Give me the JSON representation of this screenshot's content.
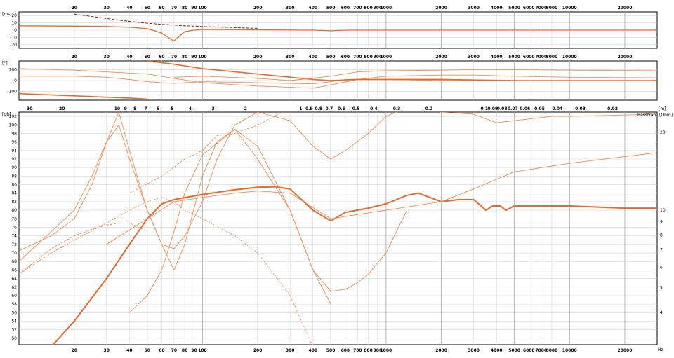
{
  "colors": {
    "grid": "#d4d4d4",
    "grid_major": "#a8a8a8",
    "frame": "#000000",
    "curve_main": "#e9692c",
    "curve_thin": "#f08a50",
    "curve_dark": "#8b1a1a"
  },
  "chart_data": [
    {
      "type": "line",
      "panel": "top",
      "xscale": "log",
      "xlim": [
        10,
        30000
      ],
      "x_ticks": [
        "20",
        "30",
        "40",
        "50",
        "60",
        "70",
        "80",
        "90",
        "100",
        "200",
        "300",
        "400",
        "500",
        "600",
        "700",
        "800",
        "900",
        "1000",
        "2000",
        "3000",
        "4000",
        "5000",
        "6000",
        "7000",
        "8000",
        "10000",
        "20000"
      ],
      "ylabel": "[ms]",
      "y_ticks": [
        "20",
        "10",
        "0",
        "-10",
        "-20"
      ],
      "ylim": [
        -25,
        25
      ],
      "series": [
        {
          "role": "group-delay",
          "x": [
            20,
            30,
            40,
            50,
            60,
            70,
            80,
            90,
            100,
            150,
            200
          ],
          "y": [
            22,
            16,
            12,
            9.5,
            8,
            7,
            6,
            5.5,
            5,
            3.5,
            2.5
          ]
        },
        {
          "role": "phase-delay",
          "x": [
            10,
            20,
            30,
            40,
            50,
            55,
            60,
            65,
            70,
            75,
            80,
            90,
            100,
            200,
            400,
            500,
            600,
            1000,
            30000
          ],
          "y": [
            6,
            5.5,
            5,
            4,
            2,
            -1,
            -4,
            -10,
            -15,
            -8,
            -2,
            0,
            1,
            0.5,
            0,
            -1,
            0,
            0,
            0
          ]
        }
      ]
    },
    {
      "type": "line",
      "panel": "middle",
      "xscale": "log",
      "xlim": [
        10,
        30000
      ],
      "x_ticks": [
        "20",
        "30",
        "40",
        "50",
        "60",
        "70",
        "80",
        "90",
        "100",
        "200",
        "300",
        "400",
        "500",
        "600",
        "700",
        "800",
        "900",
        "1000",
        "2000",
        "3000",
        "4000",
        "5000",
        "6000",
        "7000",
        "8000",
        "10000",
        "20000"
      ],
      "ylabel": "[°]",
      "y_ticks": [
        "100",
        "0",
        "-100"
      ],
      "ylim": [
        -180,
        180
      ],
      "series": [
        {
          "role": "phase-a",
          "x": [
            10,
            20,
            50,
            70,
            100,
            200,
            400,
            500,
            700,
            1000,
            2000,
            3000,
            5000,
            10000,
            30000
          ],
          "y": [
            110,
            95,
            60,
            20,
            -20,
            -50,
            -70,
            -40,
            10,
            40,
            50,
            50,
            40,
            30,
            25
          ]
        },
        {
          "role": "phase-b",
          "x": [
            10,
            20,
            30,
            40,
            50,
            60,
            70,
            80,
            100,
            200,
            400,
            500,
            600,
            1000,
            2000,
            5000,
            30000
          ],
          "y": [
            40,
            40,
            30,
            10,
            -10,
            -20,
            -25,
            -20,
            -10,
            -20,
            -30,
            -10,
            10,
            10,
            0,
            0,
            0
          ]
        },
        {
          "role": "phase-c",
          "x": [
            10,
            20,
            40,
            50
          ],
          "y": [
            -120,
            -140,
            -160,
            -170
          ]
        },
        {
          "role": "phase-d",
          "x": [
            50,
            70,
            100,
            200,
            400,
            500,
            700,
            1000,
            2000,
            5000,
            30000
          ],
          "y": [
            180,
            150,
            110,
            60,
            10,
            0,
            10,
            10,
            10,
            0,
            0
          ]
        },
        {
          "role": "phase-e",
          "x": [
            70,
            100,
            200,
            300,
            500,
            700,
            1000,
            2000,
            3000,
            5000,
            10000,
            30000
          ],
          "y": [
            30,
            40,
            20,
            0,
            40,
            80,
            90,
            95,
            100,
            100,
            95,
            90
          ]
        }
      ]
    },
    {
      "type": "line",
      "panel": "main",
      "xscale": "log",
      "xlim": [
        10,
        30000
      ],
      "x_ticks": [
        "20",
        "30",
        "40",
        "50",
        "60",
        "70",
        "80",
        "90",
        "100",
        "200",
        "300",
        "400",
        "500",
        "600",
        "700",
        "800",
        "900",
        "1000",
        "2000",
        "3000",
        "4000",
        "5000",
        "6000",
        "7000",
        "8000",
        "10000",
        "20000"
      ],
      "x_unit": "Hz",
      "wavelength_ticks": [
        "30",
        "20",
        "10",
        "9",
        "8",
        "7",
        "6",
        "5",
        "4",
        "3",
        "2",
        "1",
        "0.9",
        "0.8",
        "0.7",
        "0.6",
        "0.5",
        "0.4",
        "0.3",
        "0.2",
        "0.1",
        "0.09",
        "0.08",
        "0.07",
        "0.06",
        "0.05",
        "0.04",
        "0.03",
        "0.02"
      ],
      "wavelength_unit": "[m]",
      "ylabel": "[dB]",
      "y_ticks": [
        "102",
        "100",
        "98",
        "96",
        "94",
        "92",
        "90",
        "88",
        "86",
        "84",
        "82",
        "80",
        "78",
        "76",
        "74",
        "72",
        "70",
        "68",
        "66",
        "64",
        "62",
        "60",
        "58",
        "56",
        "54",
        "52",
        "50"
      ],
      "ylim": [
        48.5,
        103
      ],
      "y2label": "[Ohm]",
      "y2_ticks": [
        "20",
        "10",
        "9",
        "8",
        "7",
        "6",
        "5",
        "4"
      ],
      "y2lim": [
        3,
        24
      ],
      "legend_stub": "Basstrap",
      "series": [
        {
          "role": "main-response",
          "x": [
            15,
            20,
            30,
            40,
            50,
            60,
            70,
            100,
            150,
            200,
            250,
            300,
            400,
            500,
            600,
            800,
            1000,
            1300,
            1500,
            2000,
            2500,
            3000,
            3500,
            3800,
            4200,
            4500,
            5000,
            6000,
            10000,
            20000,
            30000
          ],
          "y": [
            48,
            54,
            64,
            72,
            78,
            81.5,
            82.5,
            83.7,
            84.8,
            85.4,
            85.5,
            85,
            80,
            77.5,
            79.5,
            80.5,
            81.5,
            83.5,
            84,
            82,
            82.5,
            82.5,
            80,
            81,
            81,
            80,
            81,
            81,
            81,
            80.5,
            80.5
          ]
        },
        {
          "role": "impedance",
          "x": [
            10,
            15,
            20,
            25,
            30,
            35,
            40,
            50,
            60,
            70,
            80,
            100,
            120,
            150,
            200,
            300,
            400,
            500,
            600,
            800,
            1000,
            1300,
            1500,
            2000,
            3000,
            4000,
            5000,
            8000,
            10000,
            30000
          ],
          "y": [
            70.5,
            74,
            78,
            86,
            96,
            103,
            94,
            80,
            72,
            71,
            74,
            82,
            92,
            100,
            103,
            101,
            95,
            92,
            94,
            98,
            102,
            104,
            104,
            103,
            102.5,
            100.5,
            101,
            102,
            102,
            102.5
          ]
        },
        {
          "role": "woofer-1",
          "x": [
            10,
            15,
            20,
            25,
            30,
            35,
            40,
            45,
            50
          ],
          "y": [
            65,
            71,
            74,
            75.5,
            76.5,
            77,
            77,
            76,
            75
          ]
        },
        {
          "role": "woofer-2",
          "x": [
            10,
            15,
            20,
            30,
            40,
            50,
            60,
            70,
            80,
            100,
            150,
            200,
            300,
            400
          ],
          "y": [
            65,
            70,
            73,
            77,
            80,
            82,
            83,
            82,
            80,
            78,
            74,
            70,
            60,
            48
          ]
        },
        {
          "role": "port",
          "x": [
            10,
            15,
            20,
            25,
            30,
            35,
            40,
            50,
            60,
            70,
            80,
            100,
            120,
            150,
            200,
            300,
            400,
            500,
            600,
            700,
            800,
            1000,
            1300
          ],
          "y": [
            68,
            75,
            80,
            88,
            96,
            100,
            92,
            80,
            72,
            66,
            72,
            88,
            96,
            99,
            92,
            80,
            66,
            61,
            61.5,
            63,
            65,
            70,
            80
          ]
        },
        {
          "role": "summed-thin",
          "x": [
            30,
            50,
            70,
            100,
            150,
            200,
            300,
            500,
            700,
            1000,
            2000,
            3000,
            5000,
            10000,
            30000
          ],
          "y": [
            72,
            78,
            82,
            83,
            84,
            84.5,
            84,
            78,
            79,
            80,
            82,
            85,
            89,
            91,
            93.5
          ]
        },
        {
          "role": "high-pass",
          "x": [
            40,
            60,
            80,
            100,
            120,
            150,
            200,
            300
          ],
          "y": [
            84,
            88,
            92,
            94,
            97.5,
            98,
            100,
            104
          ]
        },
        {
          "role": "cross-curve",
          "x": [
            40,
            50,
            60,
            70,
            80,
            100,
            150,
            200,
            300,
            400,
            500
          ],
          "y": [
            56,
            60,
            66,
            75,
            84,
            93,
            99,
            95,
            80,
            66,
            58
          ]
        }
      ]
    }
  ]
}
